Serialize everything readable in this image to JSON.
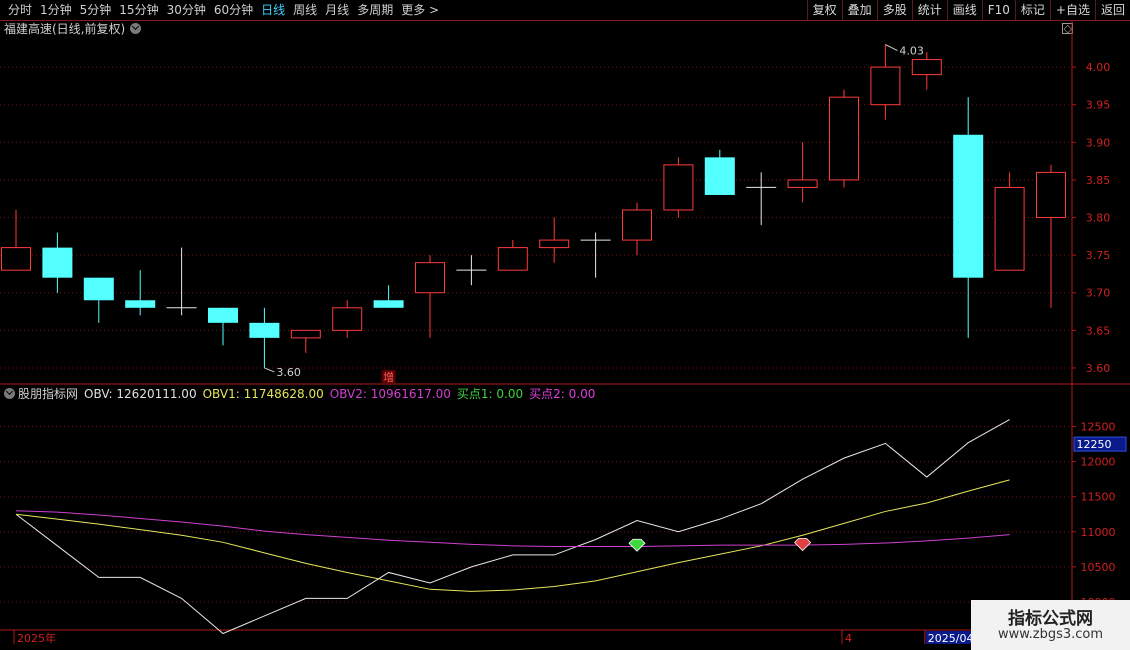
{
  "toolbar": {
    "left_items": [
      "分时",
      "1分钟",
      "5分钟",
      "15分钟",
      "30分钟",
      "60分钟",
      "日线",
      "周线",
      "月线",
      "多周期",
      "更多 >"
    ],
    "active_index": 6,
    "right_items": [
      "复权",
      "叠加",
      "多股",
      "统计",
      "画线",
      "F10",
      "标记",
      "+自选",
      "返回"
    ]
  },
  "stock_title": "福建高速(日线,前复权)",
  "indicator": {
    "name": "股朋指标网",
    "items": [
      {
        "label": "OBV: 12620111.00",
        "color": "#e0e0e0"
      },
      {
        "label": "OBV1: 11748628.00",
        "color": "#e6e65a"
      },
      {
        "label": "OBV2: 10961617.00",
        "color": "#d040d0"
      },
      {
        "label": "买点1: 0.00",
        "color": "#40d040"
      },
      {
        "label": "买点2: 0.00",
        "color": "#e040e0"
      }
    ]
  },
  "watermark": {
    "line1": "指标公式网",
    "line2": "www.zbgs3.com"
  },
  "colors": {
    "up": "#ff3a3a",
    "down": "#54ffff",
    "grid": "#7a1010",
    "axis": "#b01818"
  },
  "chart_data": [
    {
      "type": "candlestick",
      "y_ticks": [
        "4.00",
        "3.95",
        "3.90",
        "3.85",
        "3.80",
        "3.75",
        "3.70",
        "3.65",
        "3.60"
      ],
      "ylim": [
        3.58,
        4.04
      ],
      "candles": [
        {
          "o": 3.73,
          "c": 3.76,
          "h": 3.81,
          "l": 3.73
        },
        {
          "o": 3.76,
          "c": 3.72,
          "h": 3.78,
          "l": 3.7
        },
        {
          "o": 3.72,
          "c": 3.69,
          "h": 3.72,
          "l": 3.66
        },
        {
          "o": 3.69,
          "c": 3.68,
          "h": 3.73,
          "l": 3.67
        },
        {
          "o": 3.68,
          "c": 3.68,
          "h": 3.76,
          "l": 3.67
        },
        {
          "o": 3.68,
          "c": 3.66,
          "h": 3.68,
          "l": 3.63
        },
        {
          "o": 3.66,
          "c": 3.64,
          "h": 3.68,
          "l": 3.6
        },
        {
          "o": 3.64,
          "c": 3.65,
          "h": 3.65,
          "l": 3.62
        },
        {
          "o": 3.65,
          "c": 3.68,
          "h": 3.69,
          "l": 3.64
        },
        {
          "o": 3.69,
          "c": 3.68,
          "h": 3.71,
          "l": 3.68
        },
        {
          "o": 3.7,
          "c": 3.74,
          "h": 3.75,
          "l": 3.64
        },
        {
          "o": 3.73,
          "c": 3.73,
          "h": 3.75,
          "l": 3.71
        },
        {
          "o": 3.73,
          "c": 3.76,
          "h": 3.77,
          "l": 3.73
        },
        {
          "o": 3.76,
          "c": 3.77,
          "h": 3.8,
          "l": 3.74
        },
        {
          "o": 3.77,
          "c": 3.77,
          "h": 3.78,
          "l": 3.72
        },
        {
          "o": 3.77,
          "c": 3.81,
          "h": 3.82,
          "l": 3.75
        },
        {
          "o": 3.81,
          "c": 3.87,
          "h": 3.88,
          "l": 3.8
        },
        {
          "o": 3.88,
          "c": 3.83,
          "h": 3.89,
          "l": 3.83
        },
        {
          "o": 3.84,
          "c": 3.84,
          "h": 3.86,
          "l": 3.79
        },
        {
          "o": 3.84,
          "c": 3.85,
          "h": 3.9,
          "l": 3.82
        },
        {
          "o": 3.85,
          "c": 3.96,
          "h": 3.97,
          "l": 3.84
        },
        {
          "o": 3.95,
          "c": 4.0,
          "h": 4.03,
          "l": 3.93
        },
        {
          "o": 3.99,
          "c": 4.01,
          "h": 4.02,
          "l": 3.97
        },
        {
          "o": 3.91,
          "c": 3.72,
          "h": 3.96,
          "l": 3.64
        },
        {
          "o": 3.73,
          "c": 3.84,
          "h": 3.86,
          "l": 3.73
        },
        {
          "o": 3.8,
          "c": 3.86,
          "h": 3.87,
          "l": 3.68
        }
      ],
      "annotations": [
        {
          "text": "4.03",
          "index": 21,
          "value": 4.03
        },
        {
          "text": "3.60",
          "index": 6,
          "value": 3.6
        },
        {
          "text": "增",
          "index": 9,
          "value": 3.58
        }
      ]
    },
    {
      "type": "line",
      "y_ticks": [
        "12500",
        "12000",
        "11500",
        "11000",
        "10500",
        "10000"
      ],
      "ylim": [
        9600,
        12850
      ],
      "current_value_label": "12250",
      "series": [
        {
          "name": "OBV",
          "color": "#e8e8e8",
          "values": [
            11250,
            10800,
            10350,
            10350,
            10050,
            9550,
            9800,
            10050,
            10050,
            10420,
            10270,
            10500,
            10670,
            10670,
            10890,
            11160,
            11000,
            11180,
            11400,
            11750,
            12050,
            12260,
            11780,
            12270,
            12600
          ]
        },
        {
          "name": "OBV1",
          "color": "#e6e65a",
          "values": [
            11250,
            11180,
            11110,
            11030,
            10950,
            10850,
            10700,
            10550,
            10420,
            10300,
            10180,
            10150,
            10170,
            10220,
            10300,
            10430,
            10560,
            10680,
            10800,
            10950,
            11120,
            11290,
            11410,
            11580,
            11740
          ]
        },
        {
          "name": "OBV2",
          "color": "#d040d0",
          "values": [
            11300,
            11280,
            11240,
            11190,
            11140,
            11080,
            11010,
            10960,
            10920,
            10880,
            10850,
            10820,
            10800,
            10790,
            10790,
            10790,
            10800,
            10810,
            10810,
            10810,
            10820,
            10840,
            10870,
            10910,
            10960
          ]
        }
      ],
      "signals": [
        {
          "index": 15,
          "value": 10780,
          "color": "#3cd83c",
          "label": "买点1"
        },
        {
          "index": 19,
          "value": 10790,
          "color": "#e04040",
          "label": "买点2"
        }
      ]
    }
  ],
  "xaxis": {
    "labels": [
      {
        "text": "2025年",
        "index": 0
      },
      {
        "text": "4",
        "index": 20
      },
      {
        "text": "2025/04/",
        "index": 22
      }
    ]
  }
}
